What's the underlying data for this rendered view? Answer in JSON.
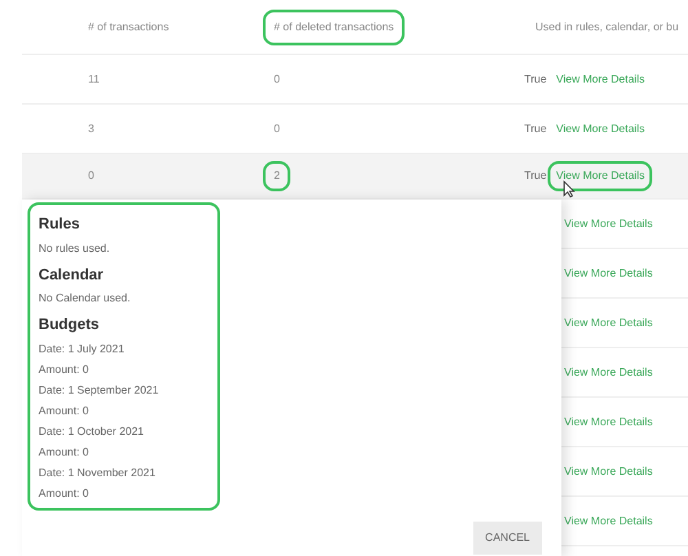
{
  "table": {
    "columns": [
      {
        "label": "# of transactions",
        "highlighted": false
      },
      {
        "label": "# of deleted transactions",
        "highlighted": true
      },
      {
        "label": "Used in rules, calendar, or bu",
        "highlighted": false
      }
    ],
    "rows": [
      {
        "transactions": "11",
        "deleted": "0",
        "deleted_highlighted": false,
        "used": "True",
        "link": "View More Details",
        "link_highlighted": false,
        "hovered": false
      },
      {
        "transactions": "3",
        "deleted": "0",
        "deleted_highlighted": false,
        "used": "True",
        "link": "View More Details",
        "link_highlighted": false,
        "hovered": false
      },
      {
        "transactions": "0",
        "deleted": "2",
        "deleted_highlighted": true,
        "used": "True",
        "link": "View More Details",
        "link_highlighted": true,
        "hovered": true
      }
    ]
  },
  "dialog": {
    "highlighted": true,
    "sections": [
      {
        "heading": "Rules",
        "lines": [
          "No rules used."
        ]
      },
      {
        "heading": "Calendar",
        "lines": [
          "No Calendar used."
        ]
      },
      {
        "heading": "Budgets",
        "lines": [
          "Date: 1 July 2021",
          "Amount: 0",
          "Date: 1 September 2021",
          "Amount: 0",
          "Date: 1 October 2021",
          "Amount: 0",
          "Date: 1 November 2021",
          "Amount: 0"
        ]
      }
    ],
    "cancel_button": "CANCEL"
  },
  "background_links": [
    "View More Details",
    "View More Details",
    "View More Details",
    "View More Details",
    "View More Details",
    "View More Details",
    "View More Details"
  ]
}
